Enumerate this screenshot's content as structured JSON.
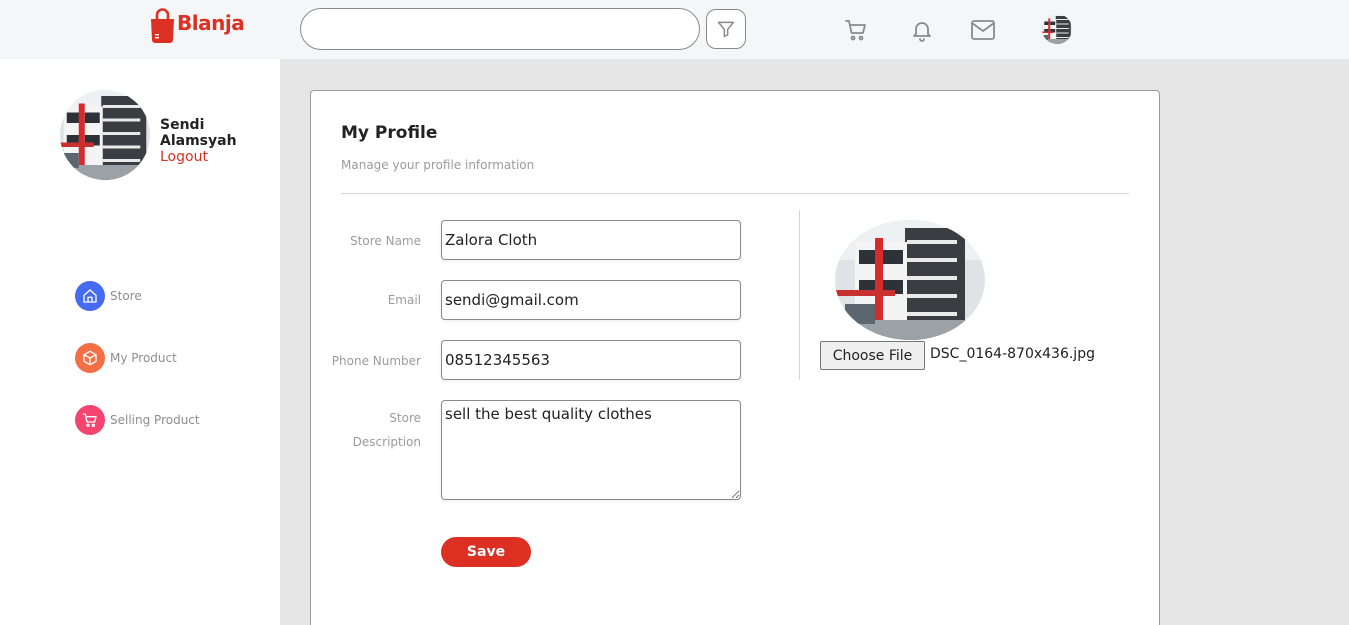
{
  "brand": {
    "name": "Blanja",
    "color": "#db3022"
  },
  "navbar": {
    "search": {
      "value": "",
      "placeholder": ""
    },
    "icons": [
      "filter-icon",
      "cart-icon",
      "bell-icon",
      "mail-icon",
      "avatar"
    ]
  },
  "sidebar": {
    "user_name": "Sendi Alamsyah",
    "logout_label": "Logout",
    "menu": [
      {
        "label": "Store",
        "icon": "home-icon",
        "color": "#456bf3"
      },
      {
        "label": "My Product",
        "icon": "box-icon",
        "color": "#f36f45"
      },
      {
        "label": "Selling Product",
        "icon": "cart-icon",
        "color": "#f3456f"
      }
    ]
  },
  "profile": {
    "title": "My Profile",
    "subtitle": "Manage your profile information",
    "fields": {
      "store_name": {
        "label": "Store Name",
        "value": "Zalora Cloth"
      },
      "email": {
        "label": "Email",
        "value": "sendi@gmail.com"
      },
      "phone": {
        "label": "Phone Number",
        "value": "08512345563"
      },
      "description": {
        "label_line1": "Store",
        "label_line2": "Description",
        "value": "sell the best quality clothes"
      }
    },
    "save_label": "Save",
    "upload": {
      "button_label": "Choose File",
      "file_name": "DSC_0164-870x436.jpg"
    }
  }
}
